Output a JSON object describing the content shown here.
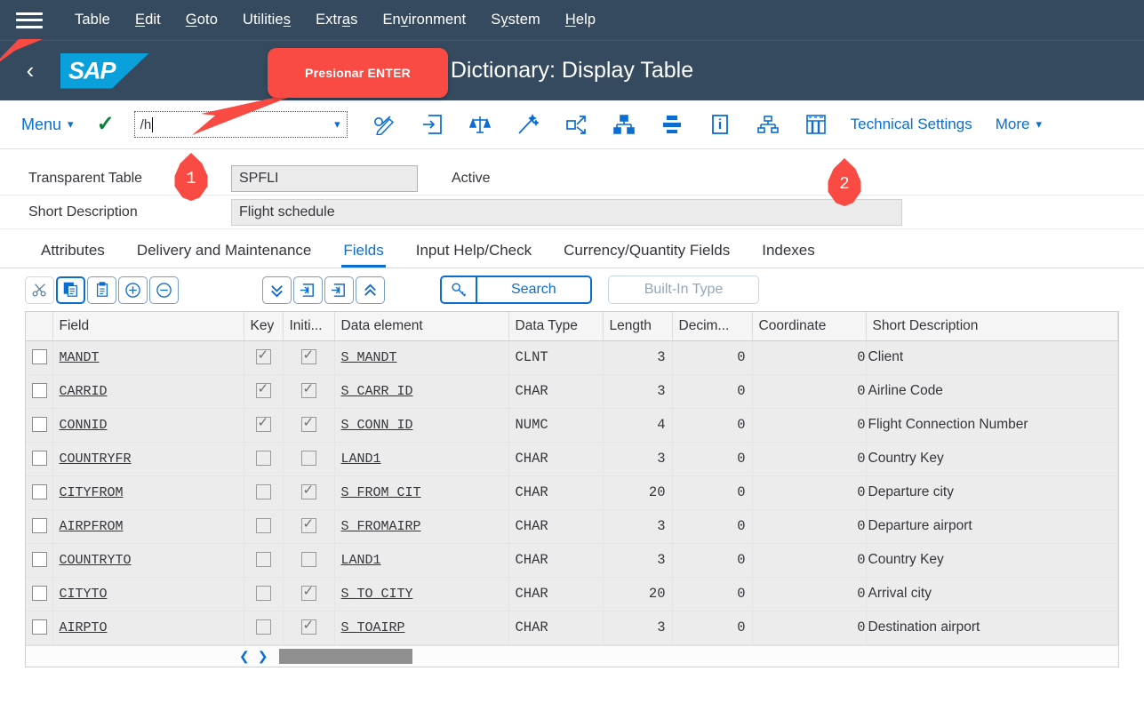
{
  "menubar": {
    "hamburger_icon": "hamburger-menu-icon",
    "items": [
      {
        "label": "Table",
        "mnemonic": ""
      },
      {
        "label": "Edit",
        "mnemonic": "E"
      },
      {
        "label": "Goto",
        "mnemonic": "G"
      },
      {
        "label": "Utilities",
        "mnemonic": "s"
      },
      {
        "label": "Extras",
        "mnemonic": "a"
      },
      {
        "label": "Environment",
        "mnemonic": "v"
      },
      {
        "label": "System",
        "mnemonic": "y"
      },
      {
        "label": "Help",
        "mnemonic": "H"
      }
    ]
  },
  "header": {
    "back_icon": "chevron-left-icon",
    "logo_text": "SAP",
    "logo_color": "#0aa0dc",
    "title": "Dictionary: Display Table",
    "bar_color": "#354a5f"
  },
  "callout": {
    "text": "Presionar ENTER",
    "color": "#f94b43"
  },
  "pins": [
    {
      "number": "1"
    },
    {
      "number": "2"
    }
  ],
  "toolbar": {
    "menu_label": "Menu",
    "menu_chevron": "chevron-down-icon",
    "confirm_icon": "green-checkmark-icon",
    "command_field": {
      "value": "/h",
      "dropdown_icon": "chevron-down-icon"
    },
    "icons": [
      {
        "name": "display-change-icon"
      },
      {
        "name": "insert-into-box-icon"
      },
      {
        "name": "scales-balance-icon"
      },
      {
        "name": "magic-wand-icon"
      },
      {
        "name": "expand-object-icon"
      },
      {
        "name": "hierarchy-where-used-icon"
      },
      {
        "name": "indent-hierarchy-icon"
      },
      {
        "name": "information-icon"
      },
      {
        "name": "hierarchy-outline-icon"
      },
      {
        "name": "table-grid-icon"
      }
    ],
    "technical_settings_label": "Technical Settings",
    "more_label": "More",
    "more_chevron": "chevron-down-icon"
  },
  "form": {
    "rows": [
      {
        "label": "Transparent Table",
        "value": "SPFLI",
        "status": "Active"
      },
      {
        "label": "Short Description",
        "value": "Flight schedule",
        "status": ""
      }
    ]
  },
  "tabs": [
    {
      "label": "Attributes",
      "active": false
    },
    {
      "label": "Delivery and Maintenance",
      "active": false
    },
    {
      "label": "Fields",
      "active": true
    },
    {
      "label": "Input Help/Check",
      "active": false
    },
    {
      "label": "Currency/Quantity Fields",
      "active": false
    },
    {
      "label": "Indexes",
      "active": false
    }
  ],
  "table_toolbar": {
    "buttons": [
      {
        "name": "cut-button",
        "icon": "scissors-icon",
        "selected": false
      },
      {
        "name": "copy-button",
        "icon": "copy-icon",
        "selected": true
      },
      {
        "name": "paste-button",
        "icon": "clipboard-icon",
        "selected": false
      },
      {
        "name": "insert-row-button",
        "icon": "plus-circle-icon",
        "selected": false
      },
      {
        "name": "delete-row-button",
        "icon": "minus-circle-icon",
        "selected": false
      },
      {
        "name": "scroll-to-bottom-button",
        "icon": "double-chevron-down-icon",
        "selected": false
      },
      {
        "name": "insert-row-below-button",
        "icon": "insert-below-icon",
        "selected": false
      },
      {
        "name": "insert-row-above-button",
        "icon": "insert-above-icon",
        "selected": false
      },
      {
        "name": "scroll-to-top-button",
        "icon": "double-chevron-up-icon",
        "selected": false
      }
    ],
    "search_icon": "key-search-icon",
    "search_label": "Search",
    "builtin_label": "Built-In Type"
  },
  "grid": {
    "columns": [
      "Field",
      "Key",
      "Initi...",
      "Data element",
      "Data Type",
      "Length",
      "Decim...",
      "Coordinate",
      "Short Description"
    ],
    "rows": [
      {
        "selected": false,
        "field": "MANDT",
        "key": true,
        "initial": true,
        "data_element": "S_MANDT",
        "data_type": "CLNT",
        "length": "3",
        "decimals": "0",
        "coordinate": "0",
        "short_description": "Client"
      },
      {
        "selected": false,
        "field": "CARRID",
        "key": true,
        "initial": true,
        "data_element": "S_CARR_ID",
        "data_type": "CHAR",
        "length": "3",
        "decimals": "0",
        "coordinate": "0",
        "short_description": "Airline Code"
      },
      {
        "selected": false,
        "field": "CONNID",
        "key": true,
        "initial": true,
        "data_element": "S_CONN_ID",
        "data_type": "NUMC",
        "length": "4",
        "decimals": "0",
        "coordinate": "0",
        "short_description": "Flight Connection Number"
      },
      {
        "selected": false,
        "field": "COUNTRYFR",
        "key": false,
        "initial": false,
        "data_element": "LAND1",
        "data_type": "CHAR",
        "length": "3",
        "decimals": "0",
        "coordinate": "0",
        "short_description": "Country Key"
      },
      {
        "selected": false,
        "field": "CITYFROM",
        "key": false,
        "initial": true,
        "data_element": "S_FROM_CIT",
        "data_type": "CHAR",
        "length": "20",
        "decimals": "0",
        "coordinate": "0",
        "short_description": "Departure city"
      },
      {
        "selected": false,
        "field": "AIRPFROM",
        "key": false,
        "initial": true,
        "data_element": "S_FROMAIRP",
        "data_type": "CHAR",
        "length": "3",
        "decimals": "0",
        "coordinate": "0",
        "short_description": "Departure airport"
      },
      {
        "selected": false,
        "field": "COUNTRYTO",
        "key": false,
        "initial": false,
        "data_element": "LAND1",
        "data_type": "CHAR",
        "length": "3",
        "decimals": "0",
        "coordinate": "0",
        "short_description": "Country Key"
      },
      {
        "selected": false,
        "field": "CITYTO",
        "key": false,
        "initial": true,
        "data_element": "S_TO_CITY",
        "data_type": "CHAR",
        "length": "20",
        "decimals": "0",
        "coordinate": "0",
        "short_description": "Arrival city"
      },
      {
        "selected": false,
        "field": "AIRPTO",
        "key": false,
        "initial": true,
        "data_element": "S_TOAIRP",
        "data_type": "CHAR",
        "length": "3",
        "decimals": "0",
        "coordinate": "0",
        "short_description": "Destination airport"
      }
    ]
  },
  "scrollbar": {
    "left_arrow": "chevron-left-icon",
    "right_arrow": "chevron-right-icon"
  }
}
